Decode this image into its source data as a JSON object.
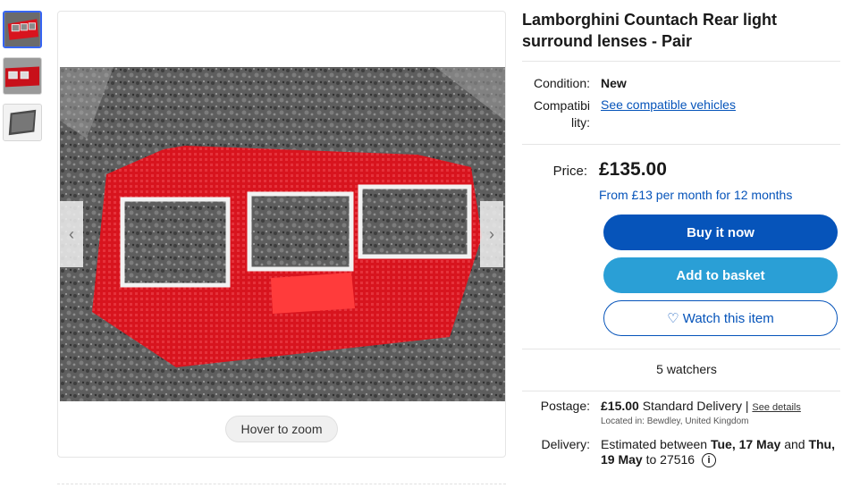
{
  "listing": {
    "title": "Lamborghini Countach Rear light surround lenses - Pair",
    "condition_label": "Condition:",
    "condition_value": "New",
    "compat_label": "Compatibi lity:",
    "compat_link": "See compatible vehicles",
    "price_label": "Price:",
    "price": "£135.00",
    "finance": "From £13 per month for 12 months",
    "buy_now": "Buy it now",
    "add_to_basket": "Add to basket",
    "watch": "Watch this item",
    "watchers": "5 watchers",
    "postage_label": "Postage:",
    "postage_price": "£15.00",
    "postage_type": "Standard Delivery",
    "postage_details": "See details",
    "location": "Located in: Bewdley, United Kingdom",
    "delivery_label": "Delivery:",
    "delivery_text": "Estimated between",
    "delivery_start": "Tue, 17 May",
    "delivery_and": "and",
    "delivery_end": "Thu, 19 May",
    "delivery_to": "to 27516"
  },
  "gallery": {
    "zoom_hint": "Hover to zoom",
    "prev_icon": "chevron-left-icon",
    "next_icon": "chevron-right-icon"
  },
  "colors": {
    "primary": "#0654ba",
    "secondary": "#2a9fd6",
    "lens_red": "#d8141e"
  }
}
